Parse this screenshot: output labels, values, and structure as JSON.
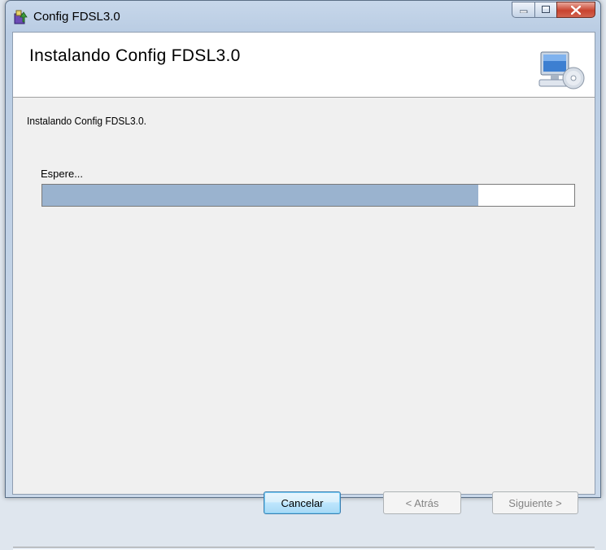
{
  "window": {
    "title": "Config FDSL3.0"
  },
  "banner": {
    "title": "Instalando Config FDSL3.0",
    "icon": "computer-cd-icon"
  },
  "main": {
    "status": "Instalando Config FDSL3.0.",
    "wait_label": "Espere...",
    "progress_fraction": 0.82
  },
  "buttons": {
    "cancel": "Cancelar",
    "back": "< Atrás",
    "next": "Siguiente >"
  },
  "colors": {
    "progress_fill": "#9ab3cf",
    "close_button": "#c8432f"
  }
}
